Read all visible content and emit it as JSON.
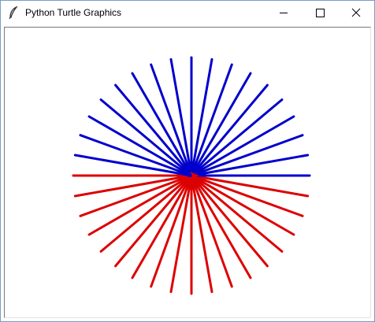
{
  "window": {
    "title": "Python Turtle Graphics",
    "app_icon": "feather-icon",
    "controls": [
      "minimize-icon",
      "maximize-icon",
      "close-icon"
    ]
  },
  "drawing": {
    "pen_colors": {
      "upper": "#0000cc",
      "lower": "#dd0000"
    },
    "ray_count_upper": 18,
    "ray_count_lower": 18,
    "ray_length": 150
  }
}
